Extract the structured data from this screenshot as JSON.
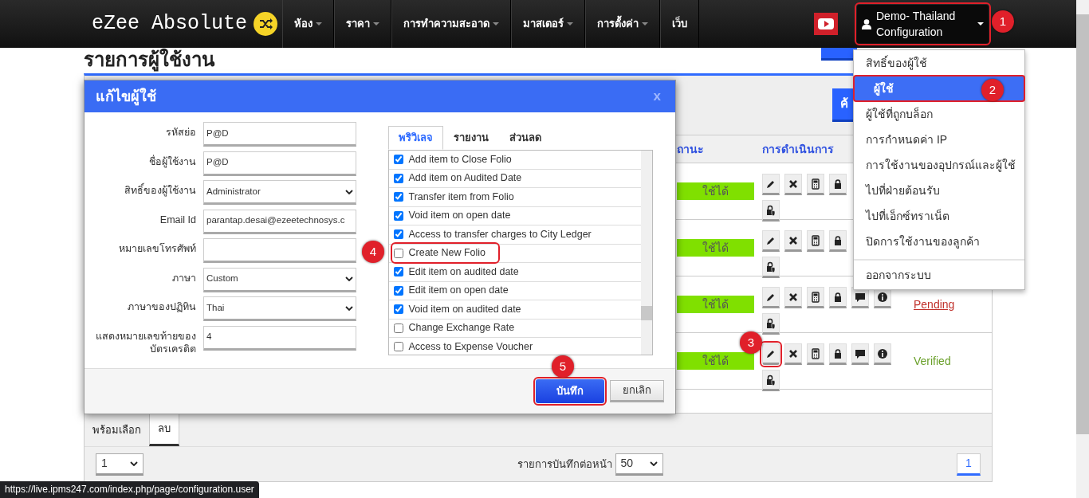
{
  "navbar": {
    "brand": "eZee Absolute",
    "menus": [
      {
        "label": "ห้อง",
        "has_caret": true
      },
      {
        "label": "ราคา",
        "has_caret": true
      },
      {
        "label": "การทำความสะอาด",
        "has_caret": true
      },
      {
        "label": "มาสเตอร์",
        "has_caret": true
      },
      {
        "label": "การตั้งค่า",
        "has_caret": true
      },
      {
        "label": "เว็บ",
        "has_caret": false
      }
    ],
    "user_menu": {
      "label": "Demo- Thailand Configuration",
      "expanded": true,
      "highlighted": true
    }
  },
  "page_title": "รายการผู้ใช้งาน",
  "search_button": "ค้",
  "table": {
    "columns": [
      "ถานะ",
      "การดำเนินการ"
    ],
    "rows": [
      {
        "status": "ใช้ได้",
        "edit_highlighted": false
      },
      {
        "status": "ใช้ได้",
        "edit_highlighted": false
      },
      {
        "status": "ใช้ได้",
        "edit_highlighted": false,
        "verification": {
          "text": "Pending",
          "kind": "link"
        }
      },
      {
        "status": "ใช้ได้",
        "edit_highlighted": true,
        "verification": {
          "text": "Verified",
          "kind": "plain"
        }
      }
    ]
  },
  "footer_tabs": [
    {
      "label": "พร้อมเลือก",
      "selected": false
    },
    {
      "label": "ลบ",
      "selected": true
    }
  ],
  "pager": {
    "page_select": "1",
    "per_page_label": "รายการบันทึกต่อหน้า",
    "per_page": "50",
    "pages": [
      {
        "label": "1",
        "selected": true
      }
    ]
  },
  "dialog": {
    "title": "แก้ไขผู้ใช้",
    "close": "x",
    "fields": [
      {
        "label": "รหัสย่อ",
        "kind": "text",
        "value": "P@D"
      },
      {
        "label": "ชื่อผู้ใช้งาน",
        "kind": "text",
        "value": "P@D"
      },
      {
        "label": "สิทธิ์ของผู้ใช้งาน",
        "kind": "select",
        "value": "Administrator"
      },
      {
        "label": "Email Id",
        "kind": "text",
        "value": "parantap.desai@ezeetechnosys.c"
      },
      {
        "label": "หมายเลขโทรศัพท์",
        "kind": "text"
      },
      {
        "label": "ภาษา",
        "kind": "select",
        "value": "Custom"
      },
      {
        "label": "ภาษาของปฏิทิน",
        "kind": "select",
        "value": "Thai"
      },
      {
        "label": "แสดงหมายเลขท้ายของบัตรเครดิต",
        "kind": "text",
        "value": "4"
      }
    ],
    "tabs": [
      {
        "label": "พริวิเลจ",
        "selected": true
      },
      {
        "label": "รายงาน",
        "selected": false
      },
      {
        "label": "ส่วนลด",
        "selected": false
      }
    ],
    "privileges": [
      {
        "label": "Add item to Close Folio",
        "checked": true,
        "highlighted": false
      },
      {
        "label": "Add item on Audited Date",
        "checked": true,
        "highlighted": false
      },
      {
        "label": "Transfer item from Folio",
        "checked": true,
        "highlighted": false
      },
      {
        "label": "Void item on open date",
        "checked": true,
        "highlighted": false
      },
      {
        "label": "Access to transfer charges to City Ledger",
        "checked": true,
        "highlighted": false
      },
      {
        "label": "Create New Folio",
        "checked": false,
        "highlighted": true
      },
      {
        "label": "Edit item on audited date",
        "checked": true,
        "highlighted": false
      },
      {
        "label": "Edit item on open date",
        "checked": true,
        "highlighted": false
      },
      {
        "label": "Void item on audited date",
        "checked": true,
        "highlighted": false
      },
      {
        "label": "Change Exchange Rate",
        "checked": false,
        "highlighted": false
      },
      {
        "label": "Access to Expense Voucher",
        "checked": false,
        "highlighted": false
      }
    ],
    "buttons": [
      {
        "label": "บันทึก",
        "kind": "primary",
        "highlighted": true
      },
      {
        "label": "ยกเลิก",
        "kind": "secondary",
        "highlighted": false
      }
    ]
  },
  "user_dropdown": {
    "items": [
      {
        "label": "สิทธิ์ของผู้ใช้",
        "selected": false,
        "highlighted": false,
        "divider_before": false
      },
      {
        "label": "ผู้ใช้",
        "selected": true,
        "highlighted": true,
        "divider_before": false
      },
      {
        "label": "ผู้ใช้ที่ถูกบล็อก",
        "selected": false,
        "highlighted": false,
        "divider_before": false
      },
      {
        "label": "การกำหนดค่า IP",
        "selected": false,
        "highlighted": false,
        "divider_before": false
      },
      {
        "label": "การใช้งานของอุปกรณ์และผู้ใช้",
        "selected": false,
        "highlighted": false,
        "divider_before": false
      },
      {
        "label": "ไปที่ฝ่ายต้อนรับ",
        "selected": false,
        "highlighted": false,
        "divider_before": false
      },
      {
        "label": "ไปที่เอ็กซ์ทราเน็ต",
        "selected": false,
        "highlighted": false,
        "divider_before": false
      },
      {
        "label": "ปิดการใช้งานของลูกค้า",
        "selected": false,
        "highlighted": false,
        "divider_before": false
      },
      {
        "label": "ออกจากระบบ",
        "selected": false,
        "highlighted": false,
        "divider_before": true
      }
    ]
  },
  "callouts": [
    "1",
    "2",
    "3",
    "4",
    "5"
  ],
  "status_url": "https://live.ipms247.com/index.php/page/configuration.user"
}
